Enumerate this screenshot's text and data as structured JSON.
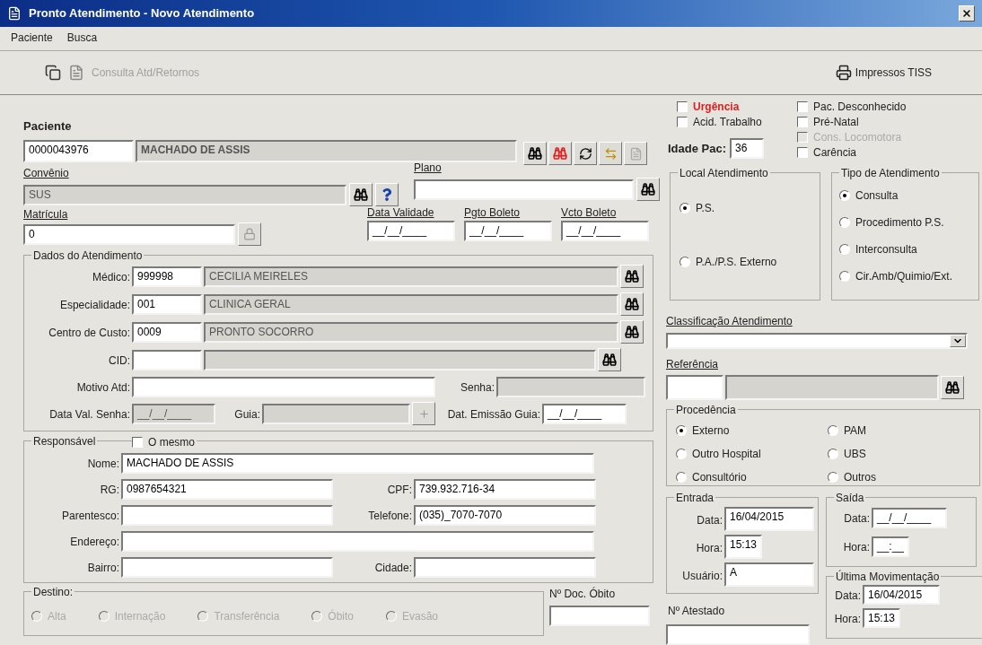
{
  "window": {
    "title": "Pronto Atendimento - Novo Atendimento"
  },
  "menu": [
    {
      "label": "Paciente"
    },
    {
      "label": "Busca"
    }
  ],
  "toolbar": {
    "consulta": {
      "label": "Consulta Atd/Retornos",
      "disabled": true
    },
    "impressos": {
      "label": "Impressos TISS"
    }
  },
  "paciente": {
    "label": "Paciente",
    "code": "0000043976",
    "name": "MACHADO DE ASSIS"
  },
  "flags_left": [
    {
      "label": "Urgência",
      "kind": "urgent",
      "checked": false,
      "disabled": false
    },
    {
      "label": "Acid. Trabalho",
      "kind": "normal",
      "checked": false,
      "disabled": false
    }
  ],
  "flags_right": [
    {
      "label": "Pac. Desconhecido",
      "kind": "normal",
      "checked": false,
      "disabled": false
    },
    {
      "label": "Pré-Natal",
      "kind": "normal",
      "checked": false,
      "disabled": false
    },
    {
      "label": "Cons. Locomotora",
      "kind": "normal",
      "checked": false,
      "disabled": true
    },
    {
      "label": "Carência",
      "kind": "normal",
      "checked": false,
      "disabled": false
    }
  ],
  "idade": {
    "label": "Idade Pac:",
    "value": "36"
  },
  "convenio": {
    "label": "Convênio",
    "value": "SUS"
  },
  "plano": {
    "label": "Plano"
  },
  "matricula": {
    "label": "Matrícula",
    "value": "0"
  },
  "boleto_dates": [
    {
      "label": "Data Validade",
      "value": "__/__/____"
    },
    {
      "label": "Pgto Boleto",
      "value": "__/__/____"
    },
    {
      "label": "Vcto Boleto",
      "value": "__/__/____"
    }
  ],
  "dados": {
    "title": "Dados do Atendimento",
    "rows": [
      {
        "label": "Médico:",
        "code": "999998",
        "name": "CECILIA MEIRELES"
      },
      {
        "label": "Especialidade:",
        "code": "001",
        "name": "CLINICA GERAL"
      },
      {
        "label": "Centro de Custo:",
        "code": "0009",
        "name": "PRONTO SOCORRO"
      },
      {
        "label": "CID:"
      }
    ],
    "motivo": {
      "label": "Motivo Atd:",
      "disabled": false
    },
    "senha": {
      "label": "Senha:",
      "disabled": true
    },
    "data_val_senha": {
      "label": "Data Val. Senha:",
      "value": "__/__/____",
      "disabled": true
    },
    "guia": {
      "label": "Guia:",
      "disabled": true
    },
    "emissao_guia": {
      "label": "Dat. Emissão Guia:",
      "value": "__/__/____",
      "disabled": false
    }
  },
  "local": {
    "title": "Local Atendimento",
    "options": [
      {
        "label": "P.S.",
        "selected": true
      },
      {
        "label": "P.A./P.S. Externo",
        "selected": false
      }
    ]
  },
  "tipo": {
    "title": "Tipo de Atendimento",
    "options": [
      {
        "label": "Consulta",
        "selected": true
      },
      {
        "label": "Procedimento P.S.",
        "selected": false
      },
      {
        "label": "Interconsulta",
        "selected": false
      },
      {
        "label": "Cir.Amb/Quimio/Ext.",
        "selected": false
      }
    ]
  },
  "classificacao": {
    "label": "Classificação Atendimento"
  },
  "referencia": {
    "label": "Referência"
  },
  "procedencia": {
    "title": "Procedência",
    "options": [
      {
        "label": "Externo",
        "selected": true
      },
      {
        "label": "PAM",
        "selected": false
      },
      {
        "label": "Outro Hospital",
        "selected": false
      },
      {
        "label": "UBS",
        "selected": false
      },
      {
        "label": "Consultório",
        "selected": false
      },
      {
        "label": "Outros",
        "selected": false
      }
    ]
  },
  "responsavel": {
    "title": "Responsável",
    "same": {
      "label": "O mesmo",
      "checked": false
    },
    "nome": {
      "label": "Nome:",
      "value": "MACHADO DE ASSIS"
    },
    "rg": {
      "label": "RG:",
      "value": "0987654321"
    },
    "cpf": {
      "label": "CPF:",
      "value": "739.932.716-34"
    },
    "parentesco": {
      "label": "Parentesco:"
    },
    "telefone": {
      "label": "Telefone:",
      "value": "(035)_7070-7070"
    },
    "endereco": {
      "label": "Endereço:"
    },
    "bairro": {
      "label": "Bairro:"
    },
    "cidade": {
      "label": "Cidade:"
    }
  },
  "destino": {
    "title": "Destino:",
    "options": [
      {
        "label": "Alta",
        "selected": false,
        "disabled": true
      },
      {
        "label": "Internação",
        "selected": false,
        "disabled": true
      },
      {
        "label": "Transferência",
        "selected": false,
        "disabled": true
      },
      {
        "label": "Óbito",
        "selected": false,
        "disabled": true
      },
      {
        "label": "Evasão",
        "selected": false,
        "disabled": true
      }
    ]
  },
  "doc_obito": {
    "label": "Nº Doc. Óbito"
  },
  "atestado": {
    "label": "Nº Atestado"
  },
  "entrada": {
    "title": "Entrada",
    "fields": [
      {
        "label": "Data:",
        "value": "16/04/2015"
      },
      {
        "label": "Hora:",
        "value": "15:13"
      },
      {
        "label": "Usuário:",
        "value": "A"
      }
    ]
  },
  "saida": {
    "title": "Saída",
    "fields": [
      {
        "label": "Data:",
        "value": "__/__/____"
      },
      {
        "label": "Hora:",
        "value": "__:__"
      }
    ]
  },
  "ultima": {
    "title": "Última Movimentação",
    "fields": [
      {
        "label": "Data:",
        "value": "16/04/2015"
      },
      {
        "label": "Hora:",
        "value": "15:13"
      }
    ]
  }
}
